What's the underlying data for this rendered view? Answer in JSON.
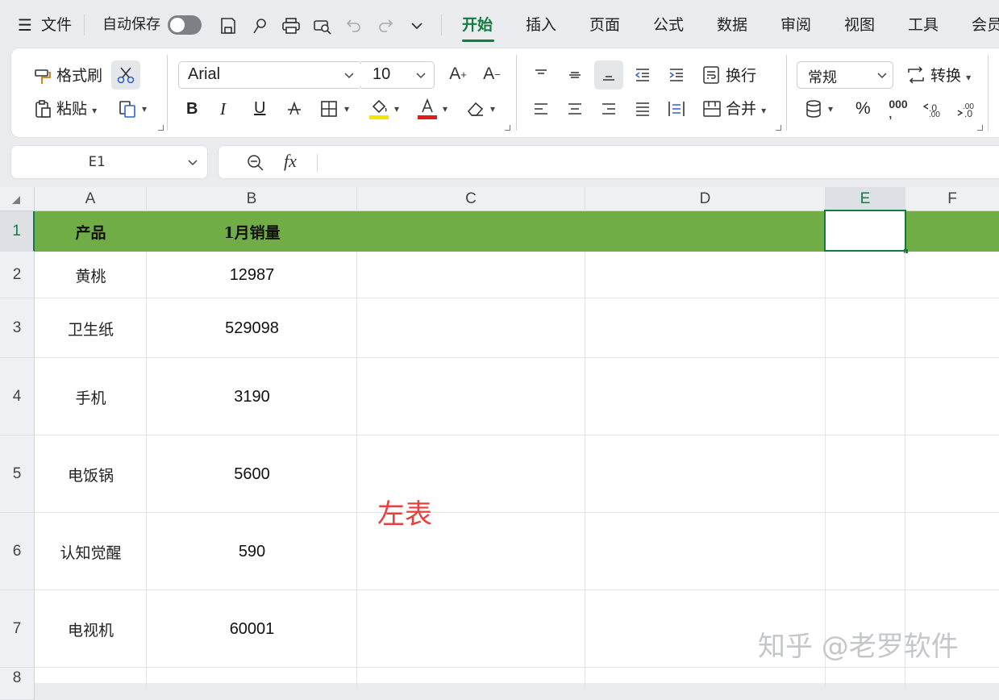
{
  "menu": {
    "file": "文件",
    "autosave": "自动保存",
    "tabs": [
      "开始",
      "插入",
      "页面",
      "公式",
      "数据",
      "审阅",
      "视图",
      "工具",
      "会员"
    ],
    "active_tab": "开始"
  },
  "ribbon": {
    "format_painter": "格式刷",
    "paste": "粘贴",
    "font_name": "Arial",
    "font_size": "10",
    "wrap": "换行",
    "merge": "合并",
    "number_format": "常规",
    "convert": "转换",
    "bold": "B",
    "italic": "I",
    "underline": "U",
    "percent": "%"
  },
  "formula_bar": {
    "name_box": "E1",
    "fx": "fx",
    "content": ""
  },
  "sheet": {
    "columns": [
      "A",
      "B",
      "C",
      "D",
      "E",
      "F"
    ],
    "selected_column": "E",
    "rows": [
      "1",
      "2",
      "3",
      "4",
      "5",
      "6",
      "7",
      "8"
    ],
    "header_row": [
      "产品",
      "1月销量"
    ],
    "data": [
      [
        "黄桃",
        "12987"
      ],
      [
        "卫生纸",
        "529098"
      ],
      [
        "手机",
        "3190"
      ],
      [
        "电饭锅",
        "5600"
      ],
      [
        "认知觉醒",
        "590"
      ],
      [
        "电视机",
        "60001"
      ]
    ],
    "annotation": "左表",
    "header_fill": "#70ad47",
    "annotation_color": "#e8413c"
  },
  "watermark": "知乎 @老罗软件"
}
